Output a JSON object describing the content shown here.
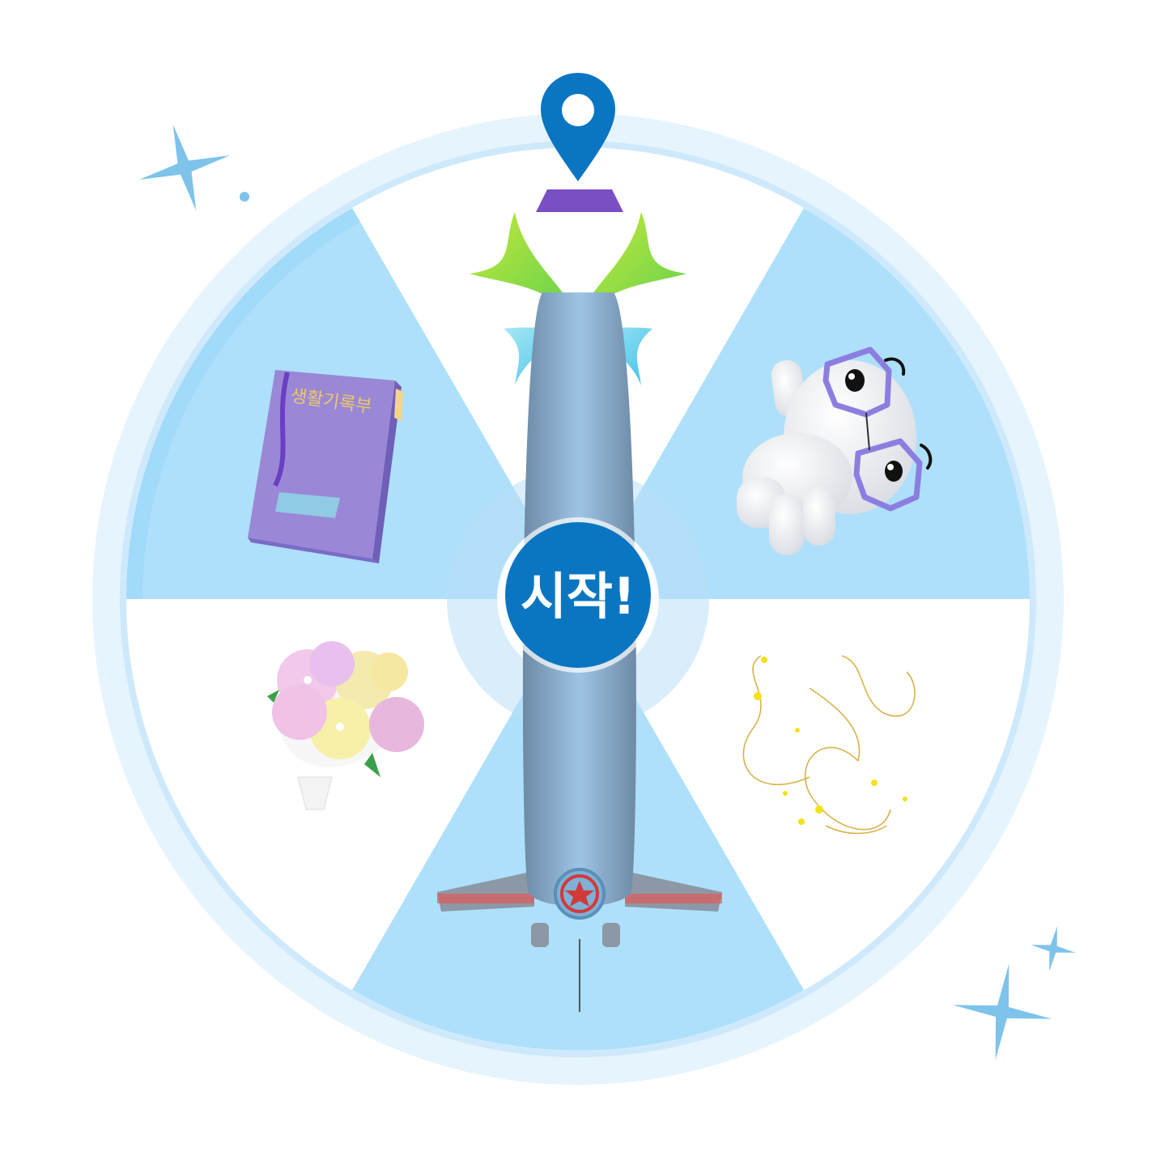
{
  "roulette": {
    "start_label": "시작!",
    "segments": [
      {
        "id": "wings",
        "prize_icon": "wings-icon"
      },
      {
        "id": "glasses-character",
        "prize_icon": "glasses-character-icon"
      },
      {
        "id": "sparkle-effect",
        "prize_icon": "golden-sparkle-effect-icon"
      },
      {
        "id": "airplane-balloon",
        "prize_icon": "airplane-balloon-icon"
      },
      {
        "id": "flower-bouquet",
        "prize_icon": "flower-bouquet-icon"
      },
      {
        "id": "record-book",
        "prize_icon": "record-book-icon"
      }
    ],
    "book_title": "생활기록부",
    "pointer_icon": "location-pin-icon"
  },
  "colors": {
    "segment_blue": "#aee0fb",
    "segment_white": "#ffffff",
    "rim": "#e3f3fd",
    "rim_inner": "#c9e8fb",
    "hub_outer": "#cfe6f6",
    "start_button": "#0a76c2",
    "pin": "#0a76c2",
    "star": "#7ec3ea"
  }
}
